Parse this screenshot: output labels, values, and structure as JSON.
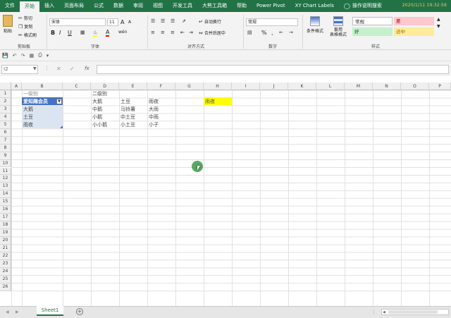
{
  "ribbon_tabs": [
    "文件",
    "开始",
    "插入",
    "页面布局",
    "公式",
    "数据",
    "审阅",
    "视图",
    "开发工具",
    "大熊工具箱",
    "帮助",
    "Power Pivot",
    "XY Chart Labels"
  ],
  "active_tab_index": 1,
  "tell_me": "操作说明搜索",
  "timestamp": "2020/1/11 19:32:56",
  "clipboard": {
    "paste": "粘贴",
    "cut": "剪切",
    "copy": "复制",
    "format_painter": "格式刷",
    "label": "剪贴板"
  },
  "font": {
    "name": "宋体",
    "size": "11",
    "grow": "A",
    "shrink": "A",
    "bold": "B",
    "italic": "I",
    "underline": "U",
    "wen": "wén",
    "label": "字体"
  },
  "alignment": {
    "wrap": "自动换行",
    "merge": "合并后居中",
    "label": "对齐方式"
  },
  "number": {
    "format": "常规",
    "percent": "%",
    "comma": ",",
    "label": "数字"
  },
  "styles": {
    "conditional": "条件格式",
    "table_format": "套用\n表格格式",
    "normal": "常规",
    "bad": "差",
    "good": "好",
    "neutral": "适中",
    "label": "样式"
  },
  "name_box": "I2",
  "fx": "fx",
  "columns": [
    "A",
    "B",
    "C",
    "D",
    "E",
    "F",
    "G",
    "H",
    "I",
    "J",
    "K",
    "L",
    "M",
    "N",
    "O",
    "P"
  ],
  "rows": [
    "1",
    "2",
    "3",
    "4",
    "5",
    "6",
    "7",
    "8",
    "9",
    "10",
    "11",
    "12",
    "13",
    "14",
    "15",
    "16",
    "17",
    "18",
    "19",
    "20",
    "21",
    "22",
    "23",
    "24",
    "25",
    "26"
  ],
  "cells": {
    "B1": "一级别",
    "B2": "爱知趣会员",
    "B3": "大鹅",
    "B4": "土豆",
    "B5": "雨夜",
    "D1": "二级别",
    "D2": "大鹅",
    "D3": "中鹅",
    "D4": "小鹅",
    "D5": "小小鹅",
    "E2": "土豆",
    "E3": "马铃薯",
    "E4": "中土豆",
    "E5": "小土豆",
    "F2": "雨夜",
    "F3": "大雨",
    "F4": "中雨",
    "F5": "小子",
    "H2": "雨夜"
  },
  "sheet_tab": "Sheet1",
  "add_sheet": "+",
  "colors": {
    "brand": "#217346",
    "selection": "#dbe5f1",
    "header_blue": "#4472c4",
    "yellow": "#ffff00",
    "bad_bg": "#ffc7ce",
    "good_bg": "#c6efce",
    "neutral_bg": "#ffeb9c"
  }
}
